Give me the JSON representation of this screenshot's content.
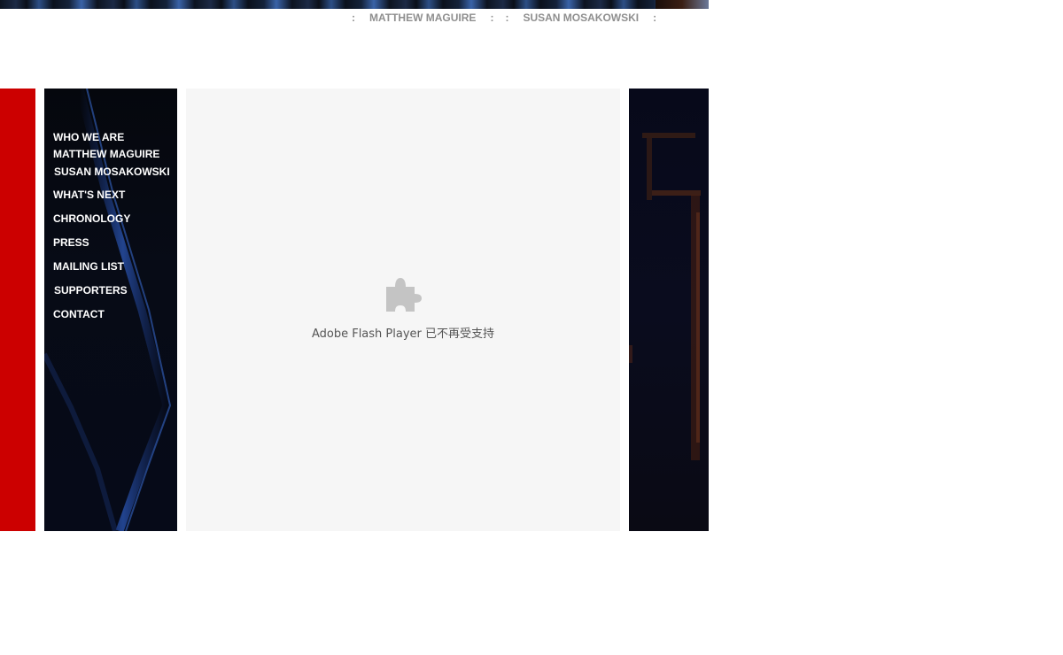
{
  "top_nav": {
    "separator": ":",
    "links": [
      "MATTHEW MAGUIRE",
      "SUSAN MOSAKOWSKI"
    ]
  },
  "side_nav": {
    "items": [
      "WHO WE ARE",
      "MATTHEW MAGUIRE",
      "SUSAN MOSAKOWSKI",
      "WHAT'S NEXT",
      "CHRONOLOGY",
      "PRESS",
      "MAILING LIST",
      "SUPPORTERS",
      "CONTACT"
    ]
  },
  "plugin": {
    "icon": "puzzle-piece-icon",
    "message": "Adobe Flash Player 已不再受支持"
  },
  "colors": {
    "red_bar": "#cc0000",
    "top_link": "#8f8f8f",
    "nav_text": "#ffffff",
    "plugin_bg": "#f6f6f6"
  }
}
